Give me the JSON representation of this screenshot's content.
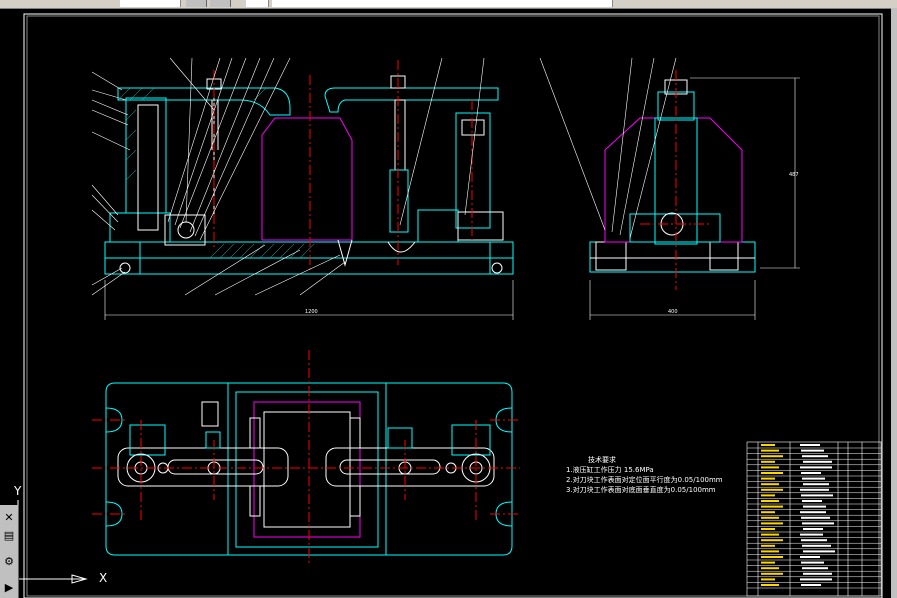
{
  "drawing": {
    "dim_total_width": "1200",
    "dim_side_width": "400",
    "dim_height": "487",
    "notes_title": "技术要求",
    "notes": [
      "1.液压缸工作压力 15.6MPa",
      "2.对刀块工作表面对定位面平行度为0.05/100mm",
      "3.对刀块工作表面对底面垂直度为0.05/100mm"
    ],
    "axis_x": "X",
    "axis_y": "Y"
  },
  "colors": {
    "background": "#000000",
    "outline": "#00ffff",
    "centerline": "#ff0000",
    "hidden": "#ff00ff",
    "detail": "#ffffff",
    "gold": "#ffd700"
  }
}
